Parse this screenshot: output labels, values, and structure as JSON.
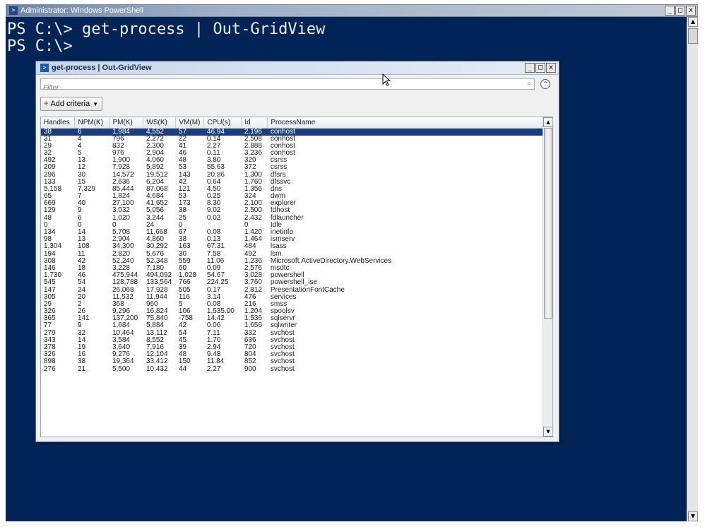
{
  "console": {
    "title": "Administrator: Windows PowerShell",
    "line1": "PS C:\\> get-process | Out-GridView",
    "line2": "PS C:\\>"
  },
  "gridview": {
    "title": "get-process | Out-GridView",
    "filter_placeholder": "Filter",
    "add_criteria_label": "Add criteria",
    "columns": [
      "Handles",
      "NPM(K)",
      "PM(K)",
      "WS(K)",
      "VM(M)",
      "CPU(s)",
      "Id",
      "ProcessName"
    ],
    "rows": [
      [
        "38",
        "6",
        "1,984",
        "4,552",
        "57",
        "46.94",
        "2,196",
        "conhost"
      ],
      [
        "31",
        "4",
        "796",
        "2,272",
        "22",
        "0.14",
        "2,508",
        "conhost"
      ],
      [
        "29",
        "4",
        "832",
        "2,300",
        "41",
        "2.27",
        "2,888",
        "conhost"
      ],
      [
        "32",
        "5",
        "976",
        "2,904",
        "46",
        "0.11",
        "3,236",
        "conhost"
      ],
      [
        "492",
        "13",
        "1,900",
        "4,060",
        "48",
        "3.80",
        "320",
        "csrss"
      ],
      [
        "209",
        "12",
        "7,928",
        "5,892",
        "53",
        "55.63",
        "372",
        "csrss"
      ],
      [
        "296",
        "30",
        "14,572",
        "19,512",
        "143",
        "20.86",
        "1,300",
        "dfsrs"
      ],
      [
        "133",
        "15",
        "2,636",
        "6,204",
        "42",
        "0.64",
        "1,760",
        "dfssvc"
      ],
      [
        "5,158",
        "7,329",
        "85,444",
        "87,068",
        "121",
        "4.50",
        "1,356",
        "dns"
      ],
      [
        "65",
        "7",
        "1,824",
        "4,684",
        "53",
        "0.25",
        "324",
        "dwm"
      ],
      [
        "669",
        "40",
        "27,100",
        "41,652",
        "173",
        "8.30",
        "2,100",
        "explorer"
      ],
      [
        "129",
        "9",
        "3,032",
        "5,056",
        "38",
        "9.02",
        "2,500",
        "fdhost"
      ],
      [
        "48",
        "6",
        "1,020",
        "3,244",
        "25",
        "0.02",
        "2,432",
        "fdlauncher"
      ],
      [
        "0",
        "0",
        "0",
        "24",
        "0",
        "",
        "0",
        "Idle"
      ],
      [
        "134",
        "14",
        "5,708",
        "11,668",
        "67",
        "0.08",
        "1,420",
        "inetinfo"
      ],
      [
        "98",
        "13",
        "2,904",
        "4,860",
        "38",
        "0.13",
        "1,464",
        "ismserv"
      ],
      [
        "1,304",
        "108",
        "34,300",
        "30,292",
        "163",
        "67.31",
        "484",
        "lsass"
      ],
      [
        "194",
        "11",
        "2,820",
        "5,676",
        "30",
        "7.58",
        "492",
        "lsm"
      ],
      [
        "308",
        "42",
        "52,240",
        "52,348",
        "559",
        "11.06",
        "1,236",
        "Microsoft.ActiveDirectory.WebServices"
      ],
      [
        "146",
        "18",
        "3,228",
        "7,180",
        "60",
        "0.09",
        "2,576",
        "msdtc"
      ],
      [
        "1,730",
        "46",
        "475,944",
        "494,092",
        "1,028",
        "54.67",
        "3,028",
        "powershell"
      ],
      [
        "545",
        "54",
        "128,788",
        "133,564",
        "766",
        "224.25",
        "3,760",
        "powershell_ise"
      ],
      [
        "147",
        "24",
        "26,068",
        "17,928",
        "505",
        "0.17",
        "2,812",
        "PresentationFontCache"
      ],
      [
        "305",
        "20",
        "11,532",
        "11,944",
        "116",
        "3.14",
        "476",
        "services"
      ],
      [
        "29",
        "2",
        "368",
        "960",
        "5",
        "0.08",
        "216",
        "smss"
      ],
      [
        "326",
        "26",
        "9,296",
        "16,824",
        "106",
        "1,535.00",
        "1,204",
        "spoolsv"
      ],
      [
        "365",
        "141",
        "137,200",
        "75,840",
        "-758",
        "14.42",
        "1,536",
        "sqlservr"
      ],
      [
        "77",
        "9",
        "1,684",
        "5,884",
        "42",
        "0.06",
        "1,656",
        "sqlwriter"
      ],
      [
        "279",
        "32",
        "10,464",
        "13,112",
        "54",
        "7.11",
        "332",
        "svchost"
      ],
      [
        "343",
        "14",
        "3,584",
        "8,552",
        "45",
        "1.70",
        "636",
        "svchost"
      ],
      [
        "278",
        "19",
        "3,640",
        "7,916",
        "39",
        "2.94",
        "720",
        "svchost"
      ],
      [
        "326",
        "16",
        "9,276",
        "12,104",
        "48",
        "9.48",
        "804",
        "svchost"
      ],
      [
        "898",
        "38",
        "19,364",
        "33,412",
        "150",
        "11.84",
        "852",
        "svchost"
      ],
      [
        "276",
        "21",
        "5,500",
        "10,432",
        "44",
        "2.27",
        "900",
        "svchost"
      ]
    ],
    "selected_row": 0
  },
  "icons": {
    "ps_icon": "powershell-icon",
    "minimize": "minimize-icon",
    "maximize": "maximize-icon",
    "close": "close-icon",
    "search": "search-icon",
    "collapse": "collapse-up-icon"
  }
}
